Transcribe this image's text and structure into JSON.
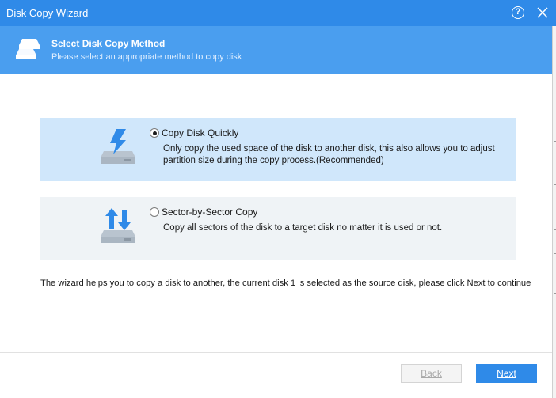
{
  "window": {
    "title": "Disk Copy Wizard",
    "help_label": "?"
  },
  "header": {
    "title": "Select Disk Copy Method",
    "subtitle": "Please select an appropriate method to copy disk"
  },
  "options": [
    {
      "label": "Copy Disk Quickly",
      "description": "Only copy the used space of the disk to another disk, this also allows you to adjust partition size during the copy process.(Recommended)",
      "selected": true,
      "icon": "disk-lightning-icon"
    },
    {
      "label": "Sector-by-Sector Copy",
      "description": "Copy all sectors of the disk to a target disk no matter it is used or not.",
      "selected": false,
      "icon": "disk-arrows-icon"
    }
  ],
  "info_text": "The wizard helps you to copy a disk to another, the current disk 1 is selected as the source disk, please click Next to continue",
  "buttons": {
    "back_label": "Back",
    "back_enabled": false,
    "next_label": "Next"
  },
  "colors": {
    "titlebar": "#2f8ae8",
    "header": "#4a9eef",
    "selected_option": "#d0e7fb",
    "unselected_option": "#eff3f6",
    "next_button": "#2f8ae8"
  }
}
